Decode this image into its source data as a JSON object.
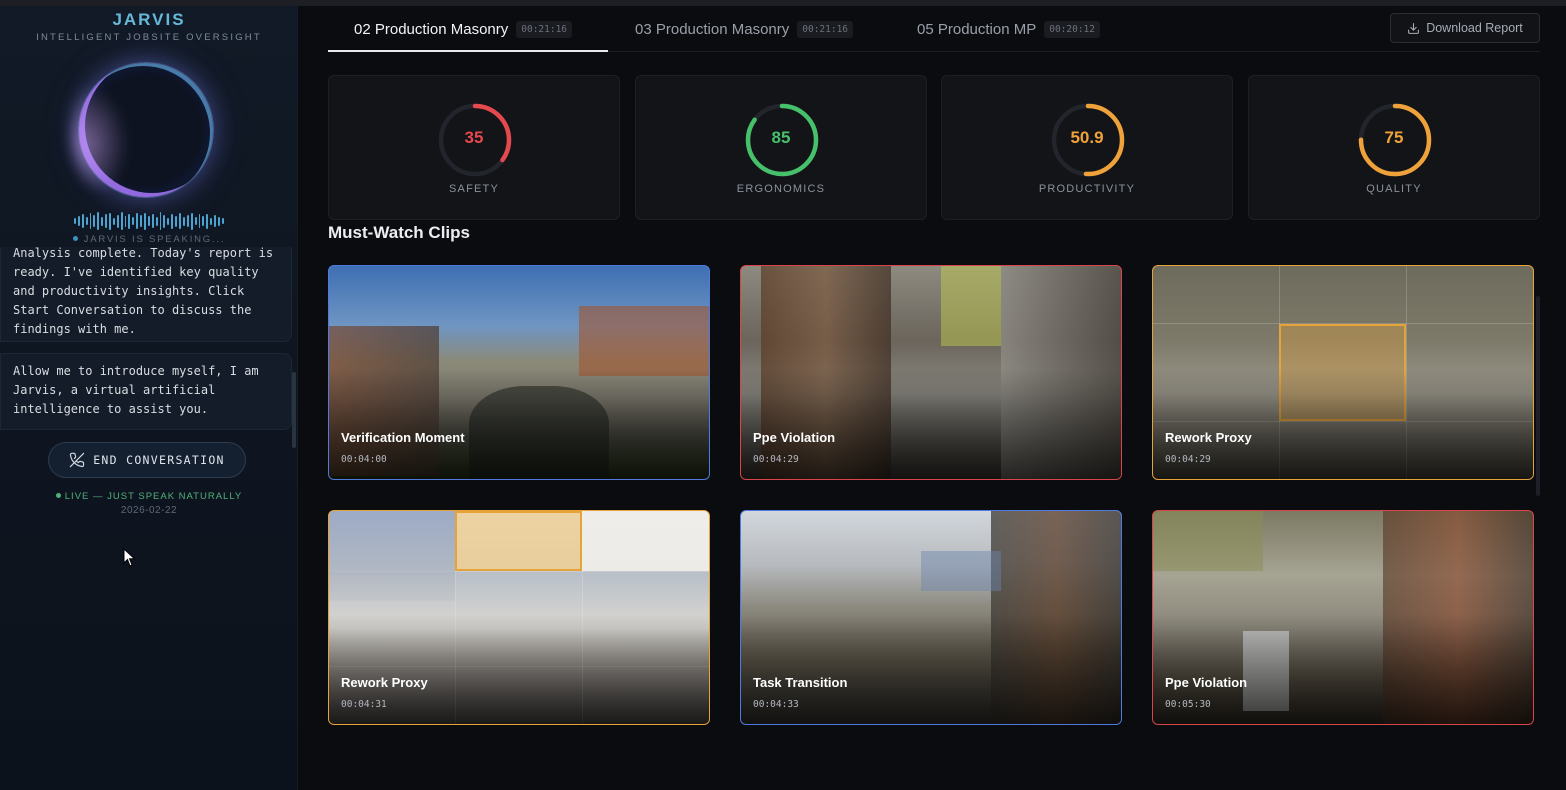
{
  "sidebar": {
    "brand": "JARVIS",
    "tagline": "INTELLIGENT JOBSITE OVERSIGHT",
    "speaking_status": "JARVIS IS SPEAKING...",
    "messages": [
      "Analysis complete. Today's report is ready. I've identified key quality and productivity insights. Click Start Conversation to discuss the findings with me.",
      "Allow me to introduce myself, I am Jarvis, a virtual artificial intelligence to assist you."
    ],
    "end_button_label": "END CONVERSATION",
    "live_status": "LIVE — JUST SPEAK NATURALLY",
    "date": "2026-02-22"
  },
  "tabs": [
    {
      "label": "02 Production Masonry",
      "time": "00:21:16",
      "active": true
    },
    {
      "label": "03 Production Masonry",
      "time": "00:21:16",
      "active": false
    },
    {
      "label": "05 Production MP",
      "time": "00:20:12",
      "active": false
    }
  ],
  "download_label": "Download Report",
  "metrics": [
    {
      "label": "SAFETY",
      "value": "35",
      "score": 35,
      "color": "#e5484d"
    },
    {
      "label": "ERGONOMICS",
      "value": "85",
      "score": 85,
      "color": "#46c06b"
    },
    {
      "label": "PRODUCTIVITY",
      "value": "50.9",
      "score": 50.9,
      "color": "#f0a23a"
    },
    {
      "label": "QUALITY",
      "value": "75",
      "score": 75,
      "color": "#f0a23a"
    }
  ],
  "section_title": "Must-Watch Clips",
  "clips": [
    {
      "title": "Verification Moment",
      "time": "00:04:00",
      "border": "#4f7be0"
    },
    {
      "title": "Ppe Violation",
      "time": "00:04:29",
      "border": "#d9454a"
    },
    {
      "title": "Rework Proxy",
      "time": "00:04:29",
      "border": "#e6a33a"
    },
    {
      "title": "Rework Proxy",
      "time": "00:04:31",
      "border": "#e6a33a"
    },
    {
      "title": "Task Transition",
      "time": "00:04:33",
      "border": "#4f7be0"
    },
    {
      "title": "Ppe Violation",
      "time": "00:05:30",
      "border": "#d9454a"
    }
  ],
  "icons": {
    "download": "download-icon",
    "end_call": "phone-off-icon",
    "cursor": "mouse-pointer-icon"
  }
}
